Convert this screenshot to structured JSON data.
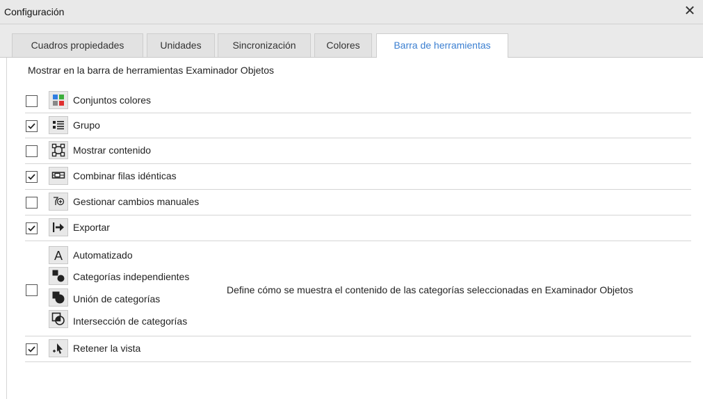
{
  "window": {
    "title": "Configuración",
    "close_glyph": "✕"
  },
  "tabs": [
    {
      "label": "Cuadros propiedades",
      "active": false
    },
    {
      "label": "Unidades",
      "active": false
    },
    {
      "label": "Sincronización",
      "active": false
    },
    {
      "label": "Colores",
      "active": false
    },
    {
      "label": "Barra de herramientas",
      "active": true
    }
  ],
  "intro": "Mostrar en la barra de herramientas Examinador Objetos",
  "items": [
    {
      "label": "Conjuntos colores",
      "checked": false,
      "icon": "color-sets-icon"
    },
    {
      "label": "Grupo",
      "checked": true,
      "icon": "group-list-icon"
    },
    {
      "label": "Mostrar contenido",
      "checked": false,
      "icon": "show-content-icon"
    },
    {
      "label": "Combinar filas idénticas",
      "checked": true,
      "icon": "merge-rows-icon"
    },
    {
      "label": "Gestionar cambios manuales",
      "checked": false,
      "icon": "manage-changes-icon"
    },
    {
      "label": "Exportar",
      "checked": true,
      "icon": "export-icon"
    }
  ],
  "category_group": {
    "checked": false,
    "options": [
      {
        "label": "Automatizado",
        "icon": "letter-a-icon"
      },
      {
        "label": "Categorías independientes",
        "icon": "independent-categories-icon"
      },
      {
        "label": "Unión de categorías",
        "icon": "union-categories-icon"
      },
      {
        "label": "Intersección de categorías",
        "icon": "intersection-categories-icon"
      }
    ],
    "description": "Define cómo se muestra el contenido de las categorías seleccionadas en Examinador Objetos"
  },
  "retain_view": {
    "label": "Retener la vista",
    "checked": true,
    "icon": "retain-view-icon"
  },
  "colors": {
    "accent": "#3b7fd1"
  }
}
